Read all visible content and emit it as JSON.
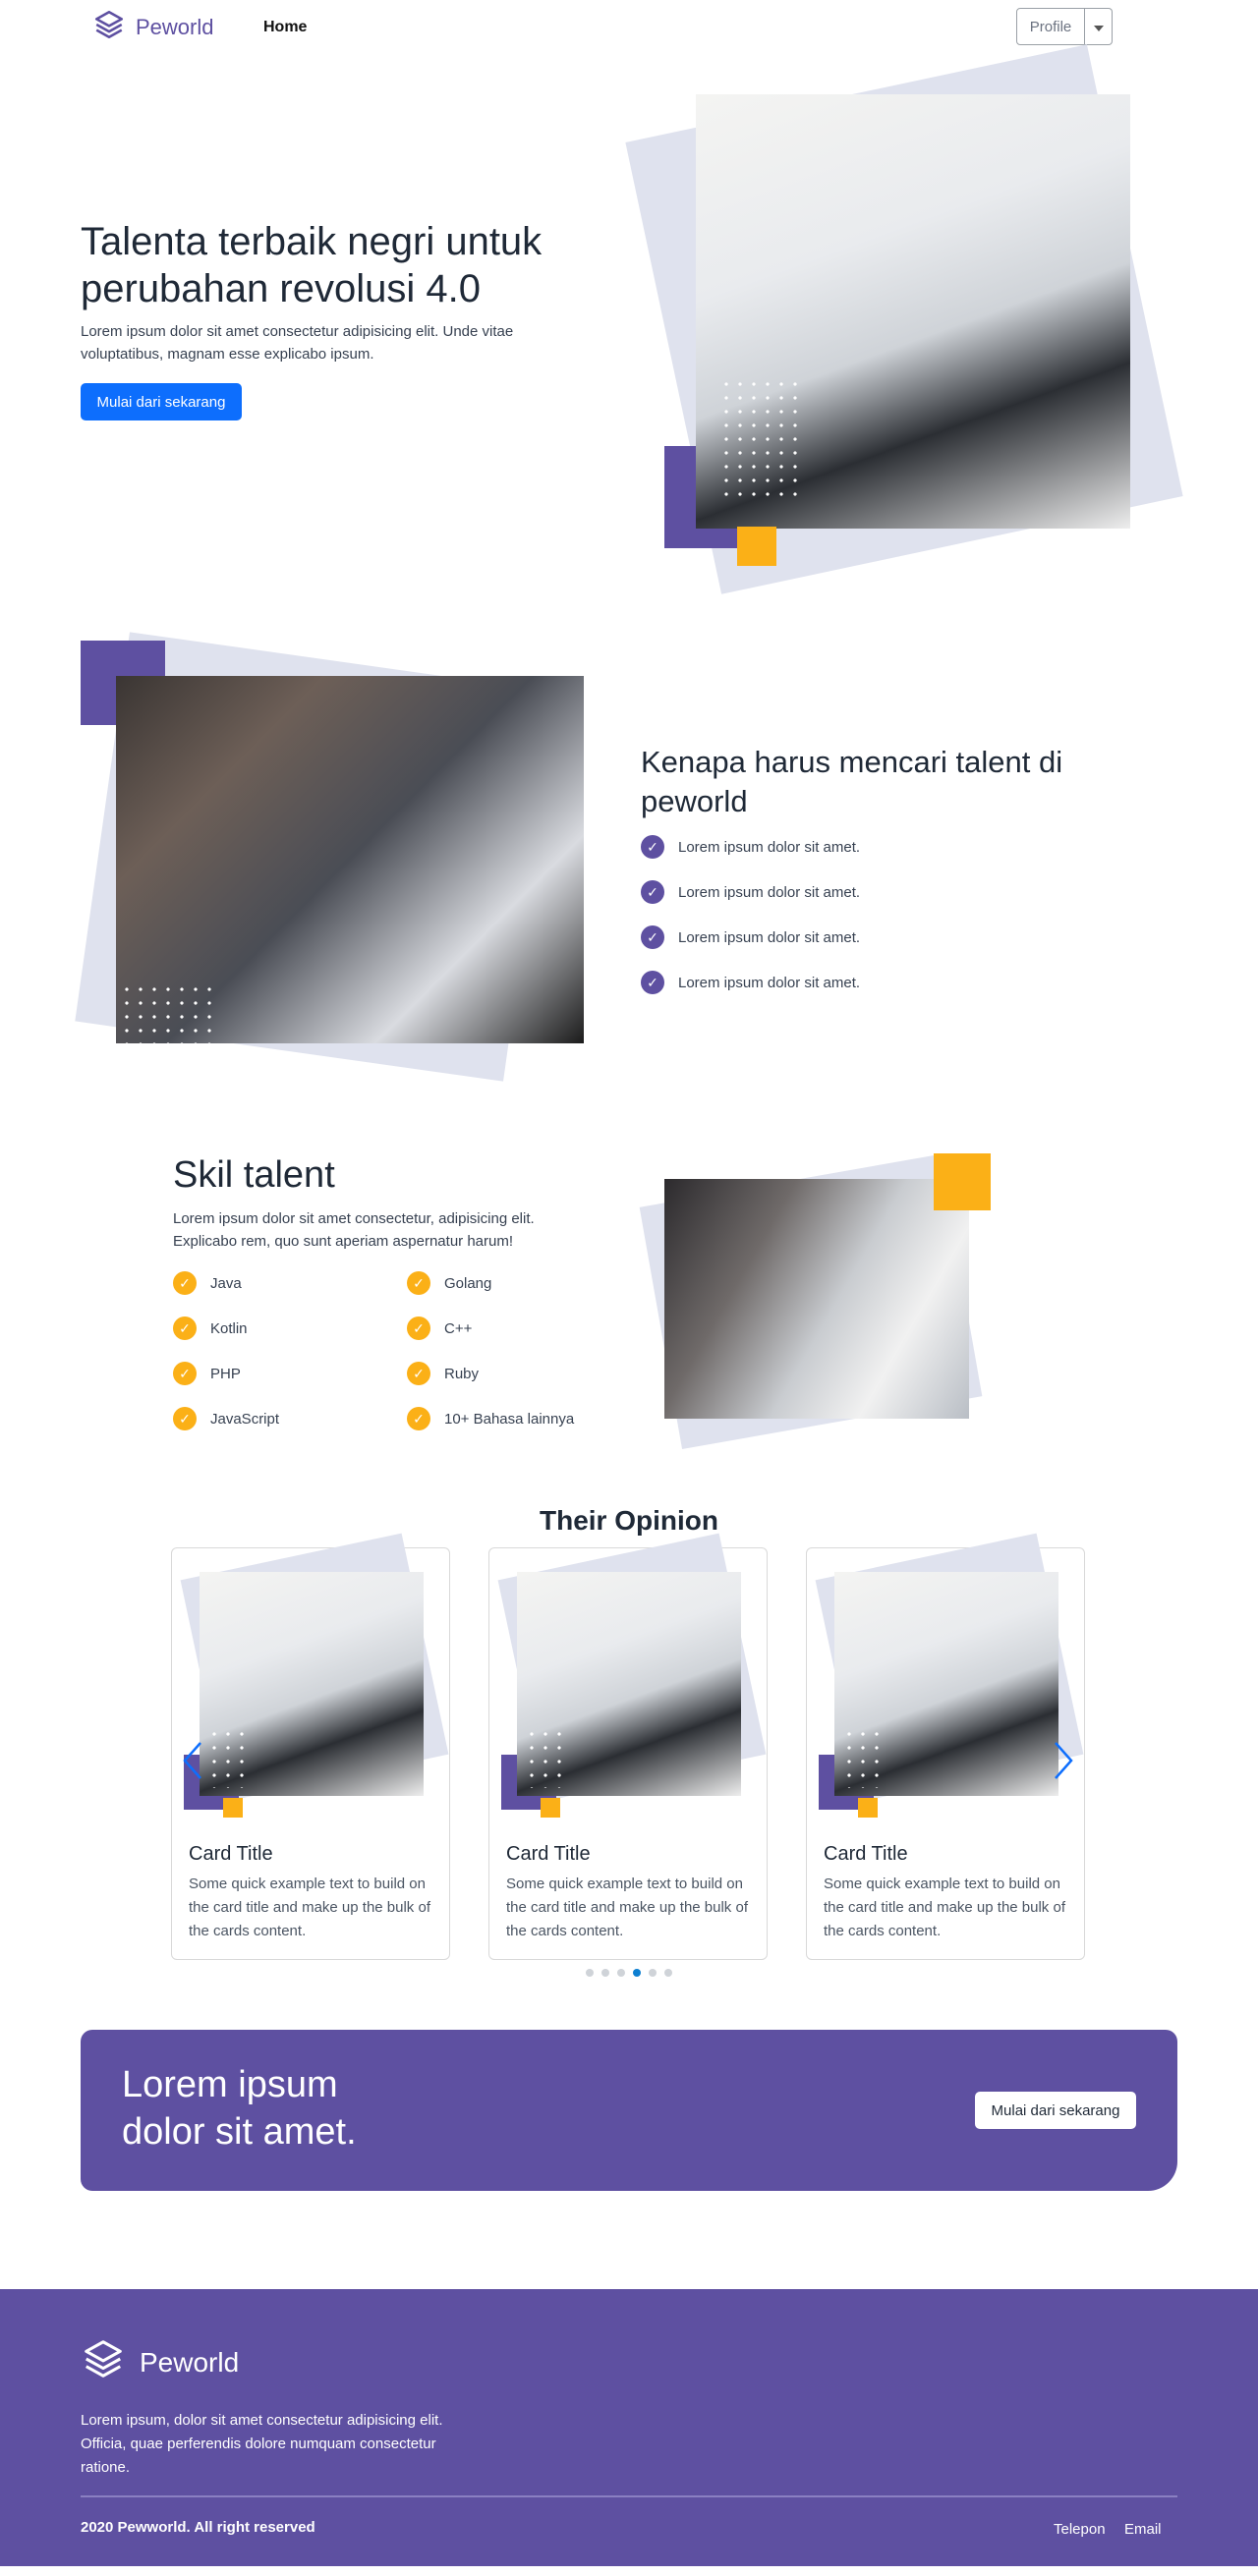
{
  "nav": {
    "brand": "Peworld",
    "home": "Home",
    "profile_label": "Profile"
  },
  "hero": {
    "title": "Talenta terbaik negri untuk perubahan revolusi 4.0",
    "text": "Lorem ipsum dolor sit amet consectetur adipisicing elit. Unde vitae voluptatibus, magnam esse explicabo ipsum.",
    "cta": "Mulai dari sekarang"
  },
  "why": {
    "title": "Kenapa harus mencari talent di peworld",
    "items": [
      "Lorem ipsum dolor sit amet.",
      "Lorem ipsum dolor sit amet.",
      "Lorem ipsum dolor sit amet.",
      "Lorem ipsum dolor sit amet."
    ]
  },
  "skills": {
    "title": "Skil talent",
    "text": "Lorem ipsum dolor sit amet consectetur, adipisicing elit. Explicabo rem, quo sunt aperiam aspernatur harum!",
    "left": [
      "Java",
      "Kotlin",
      "PHP",
      "JavaScript"
    ],
    "right": [
      "Golang",
      "C++",
      "Ruby",
      "10+ Bahasa lainnya"
    ]
  },
  "opinion": {
    "title": "Their Opinion",
    "cards": [
      {
        "title": "Card Title",
        "text": "Some quick example text to build on the card title and make up the bulk of the cards content."
      },
      {
        "title": "Card Title",
        "text": "Some quick example text to build on the card title and make up the bulk of the cards content."
      },
      {
        "title": "Card Title",
        "text": "Some quick example text to build on the card title and make up the bulk of the cards content."
      }
    ],
    "dots": 6,
    "active_dot": 3
  },
  "cta": {
    "line1": "Lorem ipsum",
    "line2": "dolor sit amet.",
    "button": "Mulai dari sekarang"
  },
  "footer": {
    "brand": "Peworld",
    "text": "Lorem ipsum, dolor sit amet consectetur adipisicing elit. Officia, quae perferendis dolore numquam consectetur ratione.",
    "copyright": "2020 Pewworld. All right reserved",
    "link_phone": "Telepon",
    "link_email": "Email"
  },
  "colors": {
    "brand_purple": "#5e50a1",
    "accent_yellow": "#fbb017",
    "primary_blue": "#0d6efd"
  },
  "icons": [
    "layers-icon",
    "caret-down-icon",
    "check-circle-icon",
    "chevron-left-icon",
    "chevron-right-icon"
  ]
}
